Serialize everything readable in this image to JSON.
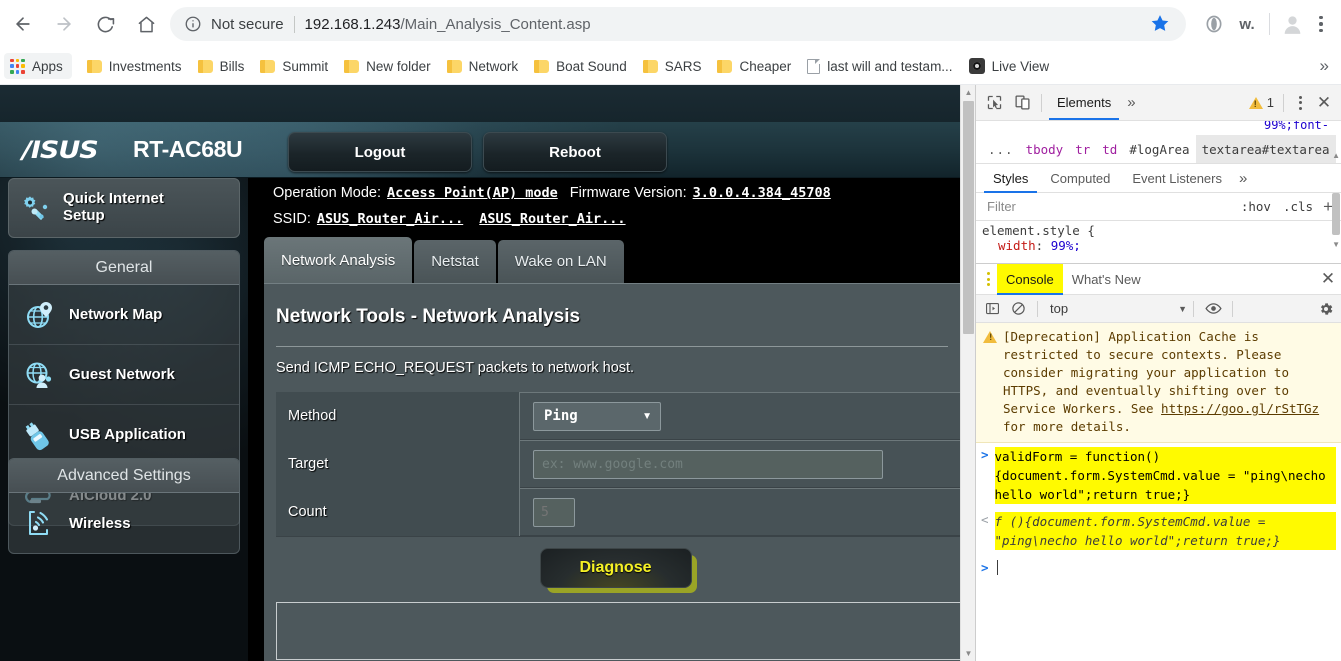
{
  "browser": {
    "nav": {
      "back": "back-arrow",
      "forward": "forward-arrow",
      "reload": "reload",
      "home": "home"
    },
    "omnibox": {
      "security_label": "Not secure",
      "url_host": "192.168.1.243",
      "url_path": "/Main_Analysis_Content.asp",
      "bookmark_star": "star-icon"
    },
    "toolbar_icons": [
      "opera-extension-icon",
      "w-extension-icon",
      "profile-avatar",
      "chrome-menu"
    ],
    "extension_w_label": "w.",
    "bookmarks": {
      "apps_label": "Apps",
      "items": [
        {
          "label": "Investments",
          "icon": "folder"
        },
        {
          "label": "Bills",
          "icon": "folder"
        },
        {
          "label": "Summit",
          "icon": "folder"
        },
        {
          "label": "New folder",
          "icon": "folder"
        },
        {
          "label": "Network",
          "icon": "folder"
        },
        {
          "label": "Boat Sound",
          "icon": "folder"
        },
        {
          "label": "SARS",
          "icon": "folder"
        },
        {
          "label": "Cheaper",
          "icon": "folder"
        },
        {
          "label": "last will and testam...",
          "icon": "document"
        },
        {
          "label": "Live View",
          "icon": "camera"
        }
      ],
      "overflow": "»"
    }
  },
  "router": {
    "brand": "/ISUS",
    "model": "RT-AC68U",
    "logout_label": "Logout",
    "reboot_label": "Reboot",
    "status": {
      "operation_mode_label": "Operation Mode:",
      "operation_mode_value": "Access Point(AP) mode",
      "firmware_label": "Firmware Version:",
      "firmware_value": "3.0.0.4.384_45708",
      "ssid_label": "SSID:",
      "ssid_value_1": "ASUS_Router_Air...",
      "ssid_value_2": "ASUS_Router_Air..."
    },
    "sidebar": {
      "quick_setup": "Quick Internet Setup",
      "general_title": "General",
      "general_items": [
        {
          "label": "Network Map",
          "icon": "network-map-icon"
        },
        {
          "label": "Guest Network",
          "icon": "guest-network-icon"
        },
        {
          "label": "USB Application",
          "icon": "usb-application-icon"
        },
        {
          "label": "AiCloud 2.0",
          "icon": "aicloud-icon"
        }
      ],
      "advanced_title": "Advanced Settings",
      "advanced_items": [
        {
          "label": "Wireless",
          "icon": "wireless-icon"
        }
      ]
    },
    "tabs": [
      {
        "label": "Network Analysis",
        "active": true
      },
      {
        "label": "Netstat",
        "active": false
      },
      {
        "label": "Wake on LAN",
        "active": false
      }
    ],
    "panel": {
      "title": "Network Tools - Network Analysis",
      "description": "Send ICMP ECHO_REQUEST packets to network host.",
      "fields": [
        {
          "label": "Method",
          "type": "select",
          "value": "Ping"
        },
        {
          "label": "Target",
          "type": "text",
          "value": "",
          "placeholder": "ex: www.google.com"
        },
        {
          "label": "Count",
          "type": "number",
          "value": "",
          "placeholder": "5"
        }
      ],
      "submit_label": "Diagnose",
      "log_area_value": ""
    }
  },
  "devtools": {
    "toolbar": {
      "inspect_icon": "inspect-element-icon",
      "device_icon": "device-toolbar-icon",
      "tabs": [
        {
          "label": "Elements",
          "active": true
        }
      ],
      "more_tabs": "»",
      "warning_count": "1",
      "menu_icon": "dots-vertical-icon",
      "close_icon": "close-icon"
    },
    "clipped_css": "99%;font-",
    "breadcrumb": [
      {
        "text": "...",
        "type": "dots"
      },
      {
        "text": "tbody",
        "type": "tag"
      },
      {
        "text": "tr",
        "type": "tag"
      },
      {
        "text": "td",
        "type": "tag"
      },
      {
        "text": "#logArea",
        "type": "id"
      },
      {
        "text": "textarea#textarea",
        "type": "selected"
      }
    ],
    "styles_tabs": [
      {
        "label": "Styles",
        "active": true
      },
      {
        "label": "Computed",
        "active": false
      },
      {
        "label": "Event Listeners",
        "active": false
      }
    ],
    "styles_more": "»",
    "filter": {
      "placeholder": "Filter",
      "value": ""
    },
    "hov_label": ":hov",
    "cls_label": ".cls",
    "plus_label": "+",
    "styles_rule": {
      "selector": "element.style {",
      "property": "width",
      "value": "99%;"
    },
    "drawer": {
      "tabs": [
        {
          "label": "Console",
          "active": true,
          "highlighted": true
        },
        {
          "label": "What's New",
          "active": false,
          "highlighted": false
        }
      ],
      "close_icon": "close-icon",
      "console_toolbar": {
        "sidebar_icon": "console-sidebar-icon",
        "clear_icon": "clear-console-icon",
        "context": "top",
        "eye_icon": "live-expression-icon",
        "settings_icon": "settings-gear-icon"
      },
      "messages": [
        {
          "type": "warning",
          "text": "[Deprecation] Application Cache is restricted to secure contexts. Please consider migrating your application to HTTPS, and eventually shifting over to Service Workers. See ",
          "link": "https://goo.gl/rStTGz",
          "text_after": " for more details."
        },
        {
          "type": "input",
          "prompt": ">",
          "text": "validForm = function(){document.form.SystemCmd.value = \"ping\\necho hello world\";return true;}"
        },
        {
          "type": "output",
          "prompt": "<",
          "text": "f (){document.form.SystemCmd.value = \"ping\\necho hello world\";return true;}"
        }
      ],
      "prompt": ">"
    }
  }
}
